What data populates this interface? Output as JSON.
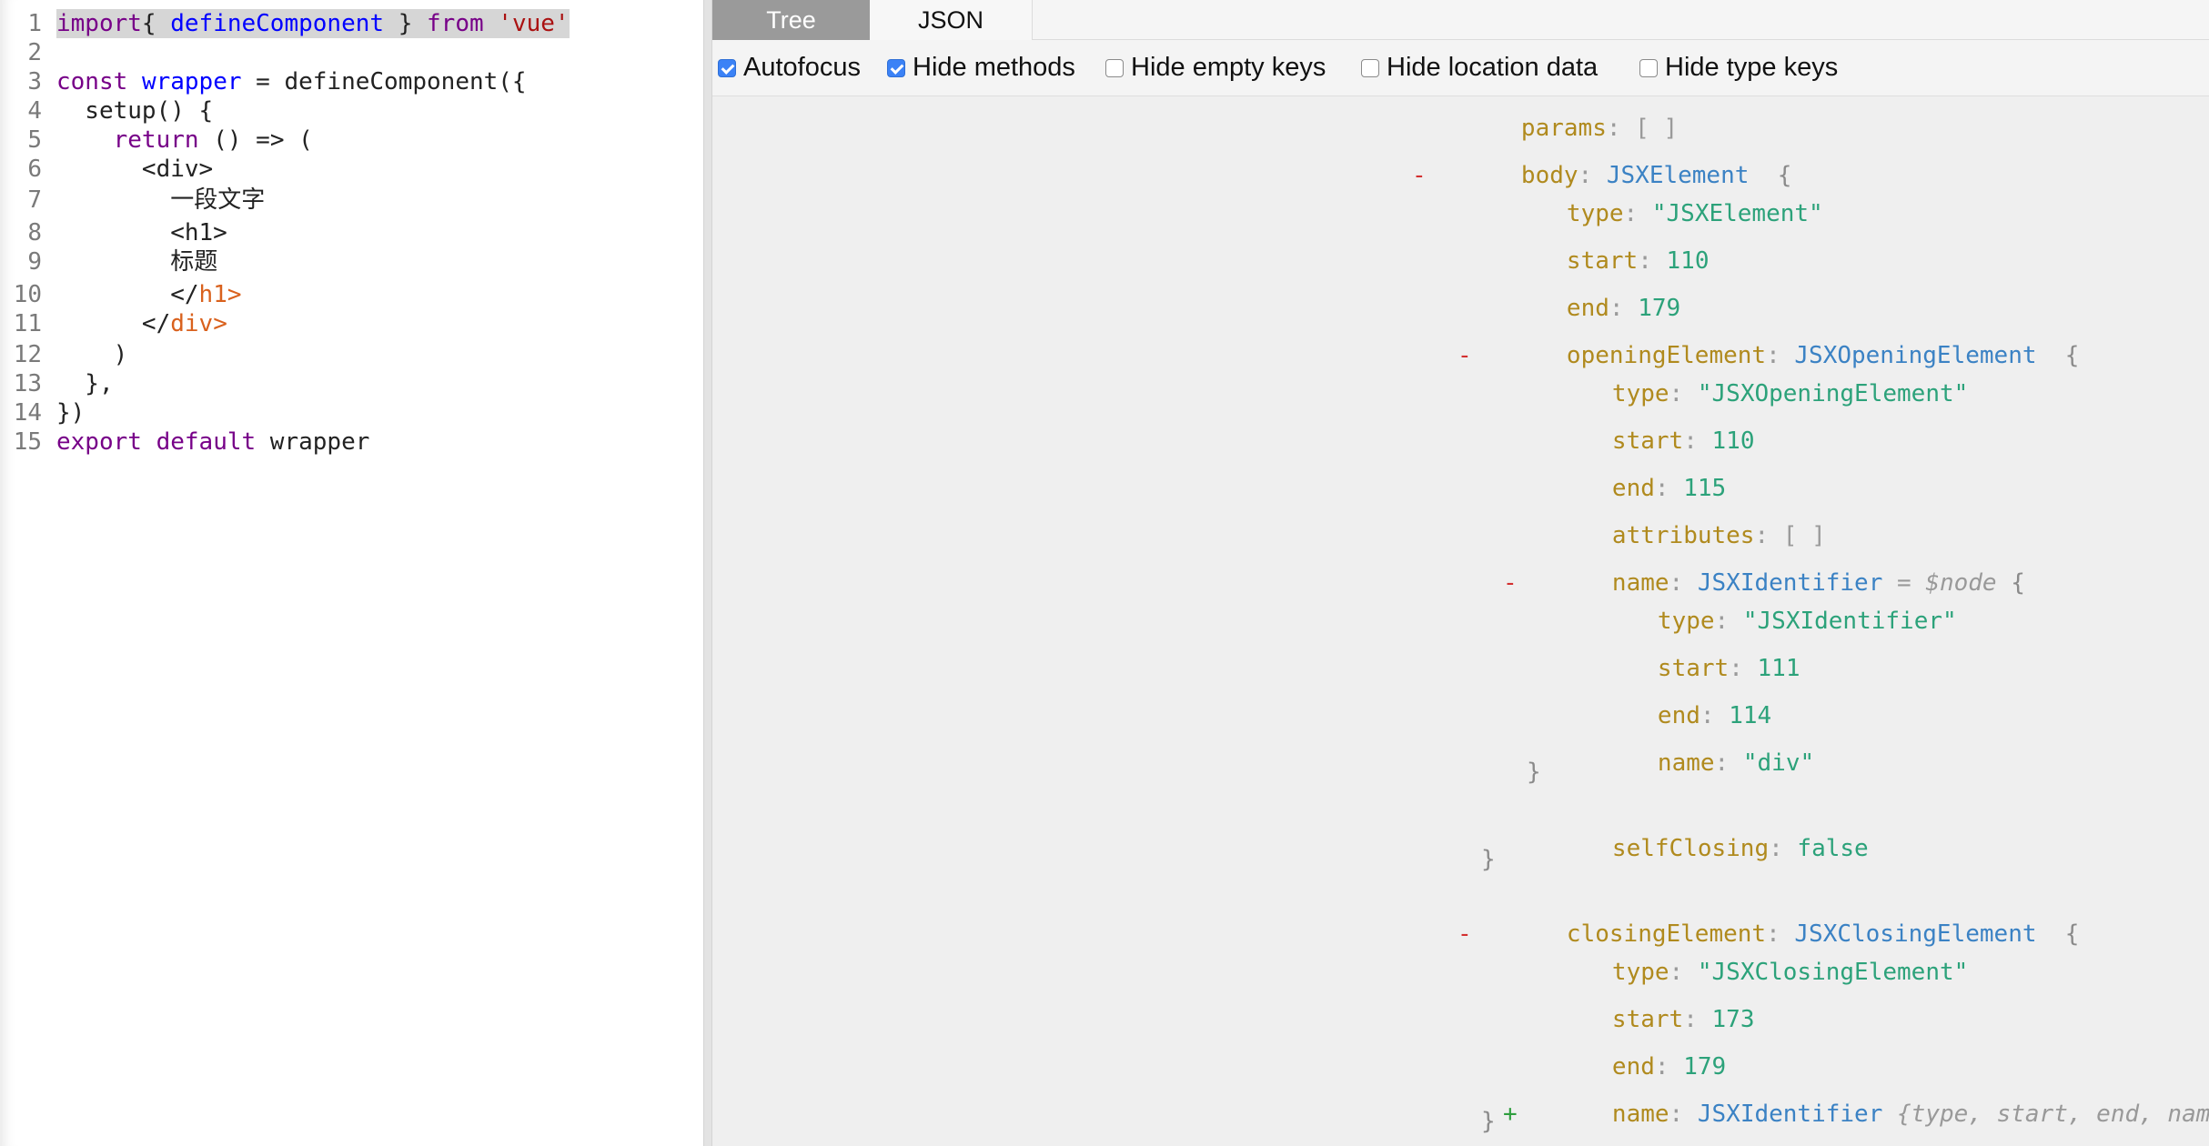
{
  "editor": {
    "lines": [
      {
        "n": "1",
        "segs": [
          [
            "kw",
            "import"
          ],
          [
            "",
            "{ "
          ],
          [
            "def",
            "defineComponent"
          ],
          [
            "",
            " } "
          ],
          [
            "kw",
            "from"
          ],
          [
            "",
            " "
          ],
          [
            "str",
            "'vue'"
          ]
        ]
      },
      {
        "n": "2",
        "segs": []
      },
      {
        "n": "3",
        "segs": [
          [
            "kw",
            "const"
          ],
          [
            "",
            " "
          ],
          [
            "def",
            "wrapper"
          ],
          [
            "",
            " = defineComponent({"
          ]
        ]
      },
      {
        "n": "4",
        "segs": [
          [
            "",
            "  setup() {"
          ]
        ]
      },
      {
        "n": "5",
        "segs": [
          [
            "",
            "    "
          ],
          [
            "kw",
            "return"
          ],
          [
            "",
            " () => ("
          ]
        ]
      },
      {
        "n": "6",
        "segs": [
          [
            "",
            "      <div>"
          ]
        ]
      },
      {
        "n": "7",
        "segs": [
          [
            "",
            "        "
          ],
          [
            "cjk",
            "一段文字"
          ]
        ]
      },
      {
        "n": "8",
        "segs": [
          [
            "",
            "        <h1>"
          ]
        ]
      },
      {
        "n": "9",
        "segs": [
          [
            "",
            "        "
          ],
          [
            "cjk",
            "标题"
          ]
        ]
      },
      {
        "n": "10",
        "segs": [
          [
            "",
            "        </"
          ],
          [
            "tag",
            "h1>"
          ]
        ]
      },
      {
        "n": "11",
        "segs": [
          [
            "",
            "      </"
          ],
          [
            "tag",
            "div>"
          ]
        ]
      },
      {
        "n": "12",
        "segs": [
          [
            "",
            "    )"
          ]
        ]
      },
      {
        "n": "13",
        "segs": [
          [
            "",
            "  },"
          ]
        ]
      },
      {
        "n": "14",
        "segs": [
          [
            "",
            "})"
          ]
        ]
      },
      {
        "n": "15",
        "segs": [
          [
            "kw",
            "export"
          ],
          [
            "",
            " "
          ],
          [
            "kw",
            "default"
          ],
          [
            "",
            " wrapper"
          ]
        ]
      }
    ]
  },
  "tabs": {
    "tree": "Tree",
    "json": "JSON",
    "active": "Tree"
  },
  "options": [
    {
      "label": "Autofocus",
      "checked": true
    },
    {
      "label": "Hide methods",
      "checked": true
    },
    {
      "label": "Hide empty keys",
      "checked": false
    },
    {
      "label": "Hide location data",
      "checked": false
    },
    {
      "label": "Hide type keys",
      "checked": false
    }
  ],
  "tree": {
    "params_key": "params",
    "params_val": "[ ]",
    "body": {
      "key": "body",
      "type": "JSXElement",
      "type_str": "\"JSXElement\"",
      "start": "110",
      "end": "179"
    },
    "opening": {
      "key": "openingElement",
      "type": "JSXOpeningElement",
      "type_str": "\"JSXOpeningElement\"",
      "start": "110",
      "end": "115",
      "attributes": "[ ]",
      "selfClosing": "false",
      "name": {
        "key": "name",
        "type": "JSXIdentifier",
        "ref": "= $node",
        "type_str": "\"JSXIdentifier\"",
        "start": "111",
        "end": "114",
        "name": "\"div\""
      }
    },
    "closing": {
      "key": "closingElement",
      "type": "JSXClosingElement",
      "type_str": "\"JSXClosingElement\"",
      "start": "173",
      "end": "179",
      "name": {
        "key": "name",
        "type": "JSXIdentifier",
        "summary": "{type, start, end, name}"
      }
    },
    "labels": {
      "type": "type",
      "start": "start",
      "end": "end",
      "attributes": "attributes",
      "selfClosing": "selfClosing",
      "name": "name"
    }
  },
  "colors": {
    "accent": "#3b82f6",
    "tab_active_bg": "#9a9a9a",
    "key": "#b08a1e",
    "value": "#2ca27a",
    "type": "#3b82c4",
    "toggle_minus": "#d32f2f",
    "toggle_plus": "#2e9e3e"
  }
}
